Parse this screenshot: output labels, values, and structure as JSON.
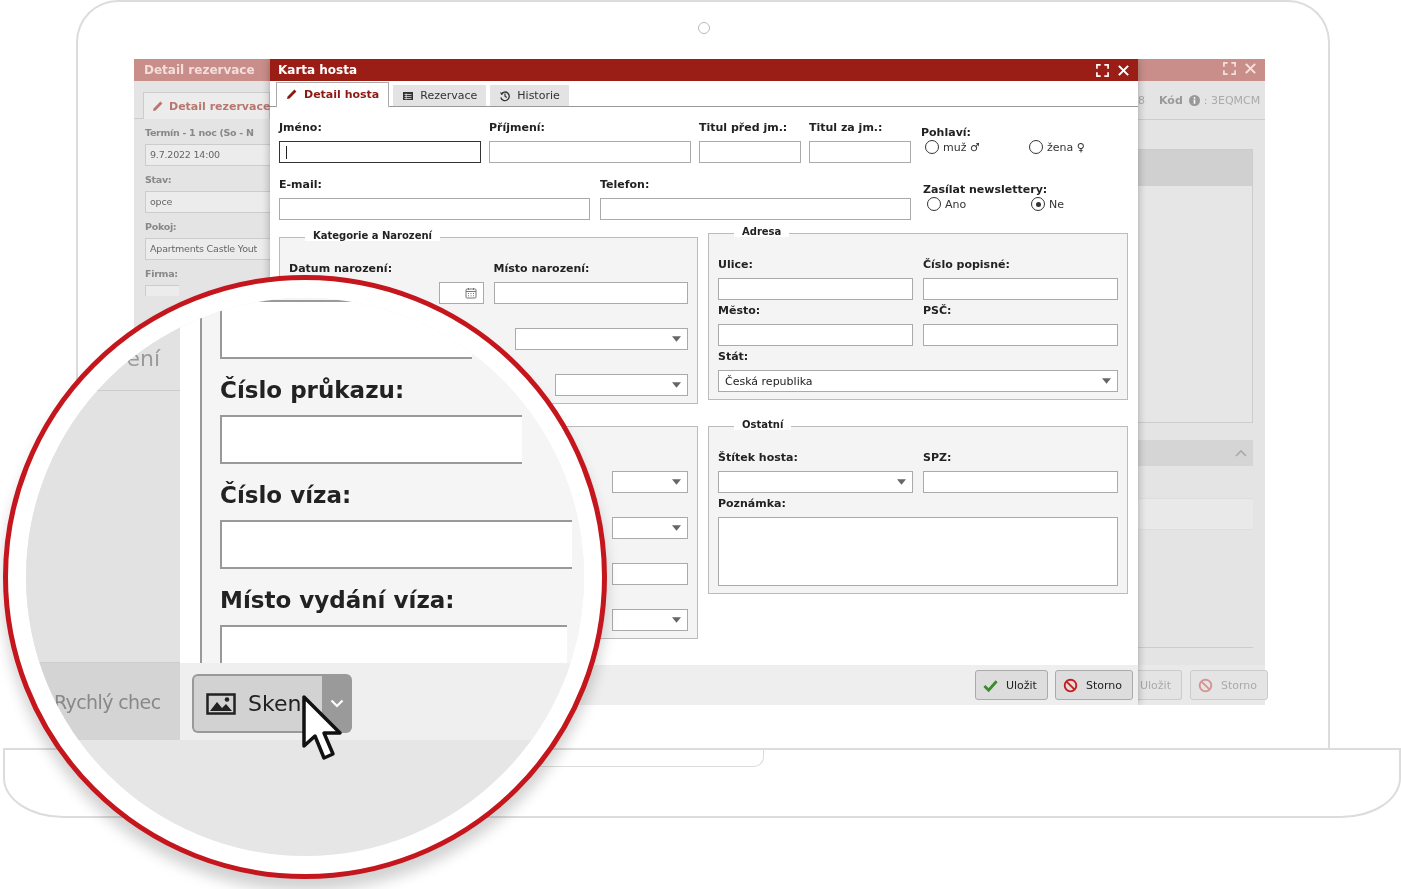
{
  "background_window": {
    "title": "Detail rezervace",
    "tab": "Detail rezervace",
    "fields": [
      {
        "label": "Termín - 1 noc (So - N",
        "value": "9.7.2022 14:00"
      },
      {
        "label": "Stav:",
        "value": "opce"
      },
      {
        "label": "Pokoj:",
        "value": "Apartments Castle Yout"
      },
      {
        "label": "Firma:"
      }
    ],
    "header_fragment": "8",
    "code_label": "Kód",
    "code_value": ": 3EQMCM",
    "buttons": [
      {
        "label": "Uložit",
        "kind": "save"
      },
      {
        "label": "Storno",
        "kind": "cancel"
      }
    ]
  },
  "dialog": {
    "title": "Karta hosta",
    "tabs": [
      {
        "label": "Detail hosta",
        "selected": true
      },
      {
        "label": "Rezervace",
        "selected": false
      },
      {
        "label": "Historie",
        "selected": false
      }
    ],
    "name_fields": [
      {
        "label": "Jméno:",
        "focused": true
      },
      {
        "label": "Příjmení:",
        "focused": false
      },
      {
        "label": "Titul před jm.:",
        "focused": false
      },
      {
        "label": "Titul za jm.:",
        "focused": false
      }
    ],
    "gender": {
      "label": "Pohlaví:",
      "options": [
        {
          "label": "muž ♂",
          "selected": false
        },
        {
          "label": "žena ♀",
          "selected": false
        }
      ]
    },
    "contact_fields": [
      {
        "label": "E-mail:",
        "focused": false
      },
      {
        "label": "Telefon:",
        "focused": false
      }
    ],
    "newsletter": {
      "label": "Zasílat newslettery:",
      "options": [
        {
          "label": "Ano",
          "selected": false
        },
        {
          "label": "Ne",
          "selected": true
        }
      ]
    },
    "groups_left": [
      {
        "legend": "Kategorie a Narození",
        "rows": [
          [
            {
              "label": "Datum narození:",
              "kind": "date"
            },
            {
              "label": "Místo narození:",
              "kind": "text"
            }
          ],
          [
            {
              "kind": "select"
            }
          ],
          [
            {
              "kind": "select"
            }
          ]
        ]
      },
      {
        "rows": [
          [
            {
              "kind": "select"
            }
          ],
          [
            {
              "kind": "select"
            }
          ],
          [
            {
              "kind": "text"
            }
          ],
          [
            {
              "kind": "select"
            }
          ]
        ]
      }
    ],
    "groups_right": [
      {
        "legend": "Adresa",
        "rows": [
          [
            {
              "label": "Ulice:",
              "kind": "text"
            },
            {
              "label": "Číslo popisné:",
              "kind": "text"
            }
          ],
          [
            {
              "label": "Město:",
              "kind": "text"
            },
            {
              "label": "PSČ:",
              "kind": "text"
            }
          ],
          [
            {
              "label": "Stát:",
              "kind": "select",
              "value": "Česká republika"
            }
          ]
        ]
      },
      {
        "legend": "Ostatní",
        "rows": [
          [
            {
              "label": "Štítek hosta:",
              "kind": "select"
            },
            {
              "label": "SPZ:",
              "kind": "text"
            }
          ],
          [
            {
              "label": "Poznámka:",
              "kind": "textarea"
            }
          ]
        ]
      }
    ],
    "buttons": [
      {
        "label": "Uložit",
        "kind": "save"
      },
      {
        "label": "Storno",
        "kind": "cancel"
      }
    ]
  },
  "magnifier": {
    "background_text": "ení",
    "fields": [
      {
        "label": "Číslo průkazu:"
      },
      {
        "label": "Číslo víza:"
      },
      {
        "label": "Místo vydání víza:"
      }
    ],
    "footer_text": "Rychlý chec",
    "scan_button": "Sken"
  }
}
